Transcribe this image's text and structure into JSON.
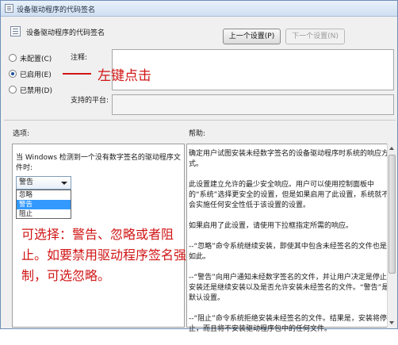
{
  "window": {
    "title": "设备驱动程序的代码签名"
  },
  "header": {
    "title": "设备驱动程序的代码签名"
  },
  "buttons": {
    "prev": "上一个设置(P)",
    "next": "下一个设置(N)"
  },
  "radios": [
    {
      "label": "未配置(C)",
      "checked": false
    },
    {
      "label": "已启用(E)",
      "checked": true
    },
    {
      "label": "已禁用(D)",
      "checked": false
    }
  ],
  "fields": {
    "comment_label": "注释:",
    "platform_label": "支持的平台:"
  },
  "annotation_1": "左键点击",
  "options": {
    "label": "选项:",
    "description": "当 Windows 检测到一个没有数字签名的驱动程序文件时:",
    "selected_value": "警告",
    "dropdown_items": [
      "忽略",
      "警告",
      "阻止"
    ]
  },
  "annotation_2": "可选择：警告、忽略或者阻止。如要禁用驱动程序签名强制，可选忽略。",
  "help": {
    "label": "帮助:",
    "paragraphs": [
      "确定用户试图安装未经数字签名的设备驱动程序时系统的响应方式。",
      "此设置建立允许的最少安全响应。用户可以使用控制面板中的“系统”选择更安全的设置，但是如果启用了此设置，系统就不会实施任何安全性低于该设置的设置。",
      "如果启用了此设置，请使用下拉框指定所需的响应。",
      "--“忽略”命令系统继续安装，即使其中包含未经签名的文件也是如此。",
      "--“警告”向用户通知未经数字签名的文件，并让用户决定是停止安装还是继续安装以及是否允许安装未经签名的文件。“警告”是默认设置。",
      "--“阻止”命令系统拒绝安装未经签名的文件。结果是，安装将停止，而且将不安装驱动程序包中的任何文件。"
    ]
  }
}
